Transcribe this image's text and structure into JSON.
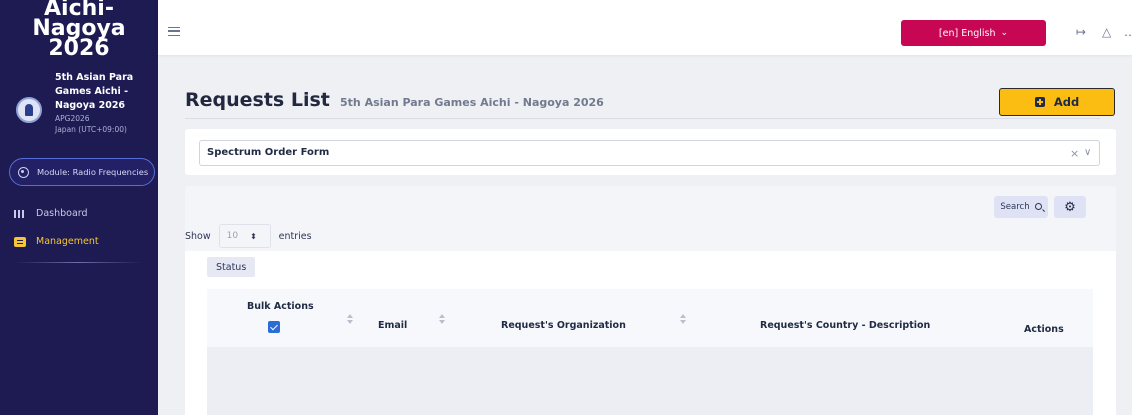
{
  "sidebar": {
    "brand_line1": "Aichi-Nagoya",
    "brand_line2": "2026",
    "event": {
      "name_line1": "5th Asian Para",
      "name_line2": "Games Aichi -",
      "name_line3": "Nagoya 2026",
      "code": "APG2026",
      "timezone": "Japan (UTC+09:00)"
    },
    "module_label": "Module: Radio Frequencies",
    "items": [
      {
        "label": "Dashboard",
        "icon": "grid-icon",
        "active": false
      },
      {
        "label": "Management",
        "icon": "id-card-icon",
        "active": true
      }
    ]
  },
  "topbar": {
    "language": "[en] English",
    "icons": [
      "logout-icon",
      "bell-icon",
      "more-icon"
    ]
  },
  "page": {
    "title": "Requests List",
    "subtitle": "5th Asian Para Games Aichi - Nagoya 2026",
    "add_label": "Add"
  },
  "form_select": {
    "value": "Spectrum Order Form"
  },
  "table": {
    "search_label": "Search",
    "show_label": "Show",
    "entries_value": "10",
    "entries_label": "entries",
    "status_label": "Status",
    "columns": [
      {
        "label": "Bulk Actions"
      },
      {
        "label": "Email"
      },
      {
        "label": "Request's Organization"
      },
      {
        "label": "Request's Country - Description"
      },
      {
        "label": "Actions"
      }
    ]
  },
  "colors": {
    "sidebar_bg": "#1d1b52",
    "accent_yellow": "#fbbd12",
    "lang_button": "#c70654",
    "checkbox_blue": "#2a6cd8"
  }
}
